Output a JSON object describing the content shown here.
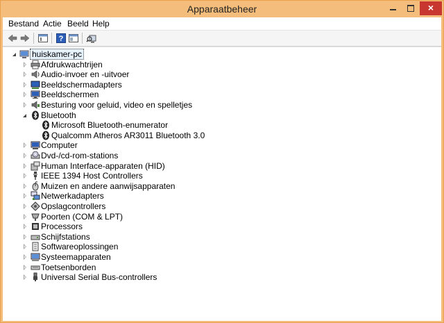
{
  "window": {
    "title": "Apparaatbeheer",
    "close_glyph": "×",
    "accent_color": "#f4bd7b",
    "close_color": "#c7372f"
  },
  "menu": {
    "items": [
      "Bestand",
      "Actie",
      "Beeld",
      "Help"
    ]
  },
  "toolbar": {
    "icons": [
      "back-arrow-icon",
      "forward-arrow-icon",
      "properties-window-icon",
      "help-icon",
      "show-hide-console-tree-icon",
      "scan-hardware-icon"
    ]
  },
  "tree": {
    "root": "huiskamer-pc",
    "categories": [
      {
        "label": "Afdrukwachtrijen",
        "icon": "printer-icon"
      },
      {
        "label": "Audio-invoer en -uitvoer",
        "icon": "speaker-icon"
      },
      {
        "label": "Beeldschermadapters",
        "icon": "display-adapter-icon"
      },
      {
        "label": "Beeldschermen",
        "icon": "monitor-icon"
      },
      {
        "label": "Besturing voor geluid, video en spelletjes",
        "icon": "sound-controller-icon"
      },
      {
        "label": "Bluetooth",
        "icon": "bluetooth-icon",
        "expanded": true,
        "children": [
          "Microsoft Bluetooth-enumerator",
          "Qualcomm Atheros AR3011 Bluetooth 3.0"
        ]
      },
      {
        "label": "Computer",
        "icon": "computer-icon"
      },
      {
        "label": "Dvd-/cd-rom-stations",
        "icon": "optical-drive-icon"
      },
      {
        "label": "Human Interface-apparaten (HID)",
        "icon": "hid-icon"
      },
      {
        "label": "IEEE 1394 Host Controllers",
        "icon": "ieee1394-icon"
      },
      {
        "label": "Muizen en andere aanwijsapparaten",
        "icon": "mouse-icon"
      },
      {
        "label": "Netwerkadapters",
        "icon": "network-adapter-icon"
      },
      {
        "label": "Opslagcontrollers",
        "icon": "storage-controller-icon"
      },
      {
        "label": "Poorten (COM & LPT)",
        "icon": "port-icon"
      },
      {
        "label": "Processors",
        "icon": "processor-icon"
      },
      {
        "label": "Schijfstations",
        "icon": "disk-drive-icon"
      },
      {
        "label": "Softwareoplossingen",
        "icon": "software-component-icon"
      },
      {
        "label": "Systeemapparaten",
        "icon": "system-device-icon"
      },
      {
        "label": "Toetsenborden",
        "icon": "keyboard-icon"
      },
      {
        "label": "Universal Serial Bus-controllers",
        "icon": "usb-icon"
      }
    ]
  }
}
